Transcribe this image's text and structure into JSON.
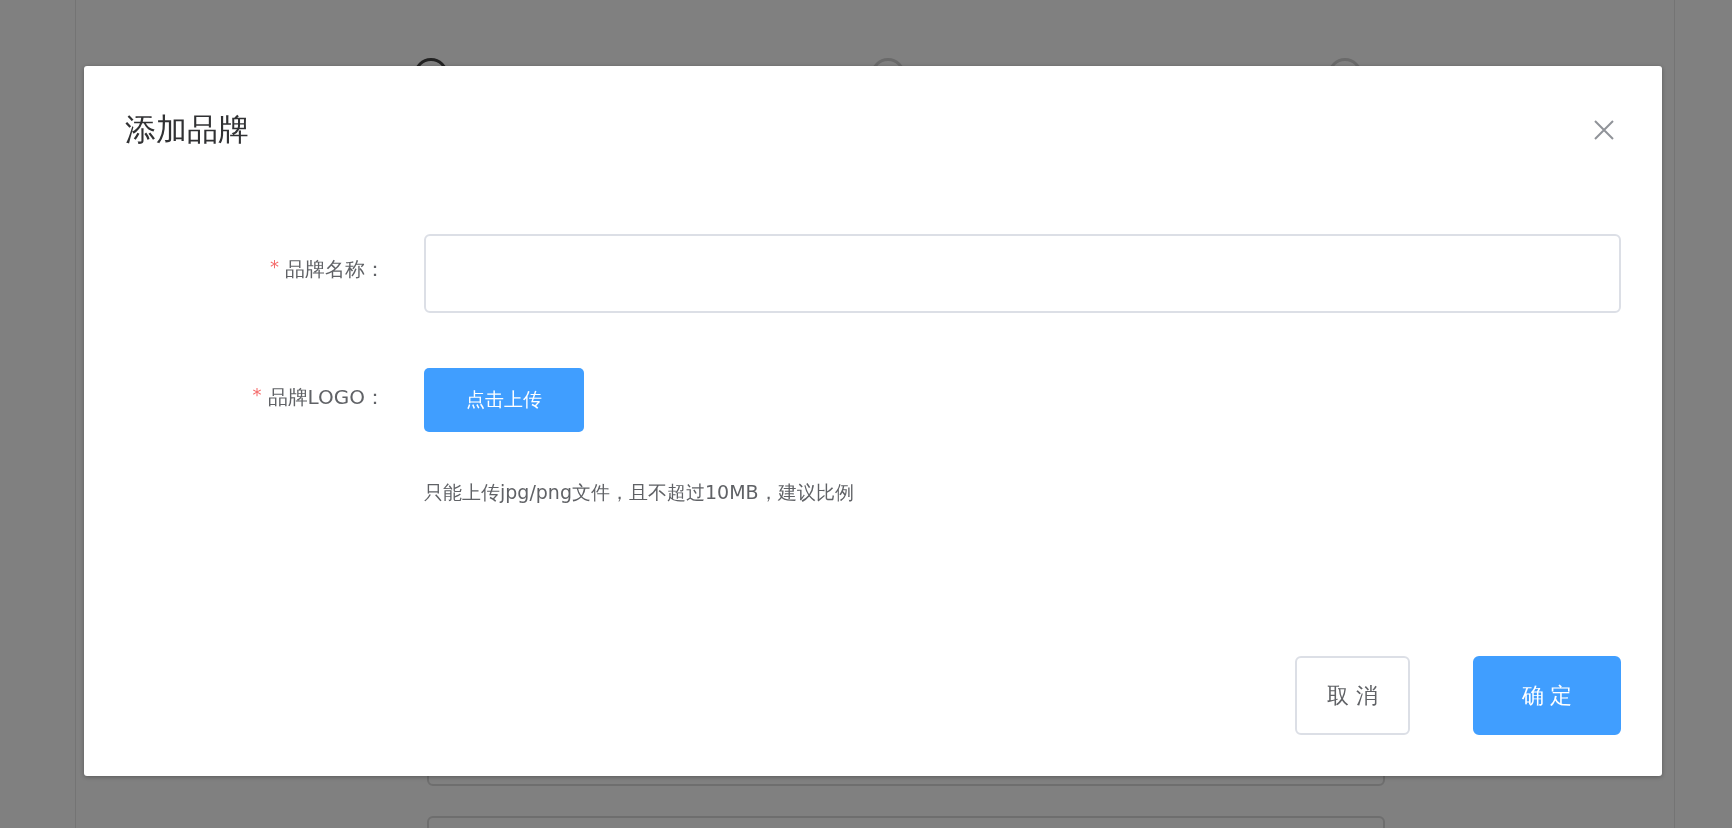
{
  "dialog": {
    "title": "添加品牌",
    "fields": [
      {
        "kind": "input",
        "mark": "*",
        "label": "品牌名称："
      },
      {
        "kind": "upload",
        "mark": "*",
        "label": "品牌LOGO：",
        "button": "点击上传",
        "hint": "只能上传jpg/png文件，且不超过10MB，建议比例"
      }
    ],
    "buttons": [
      {
        "kind": "default",
        "label": "取 消"
      },
      {
        "kind": "primary",
        "label": "确 定"
      }
    ]
  }
}
